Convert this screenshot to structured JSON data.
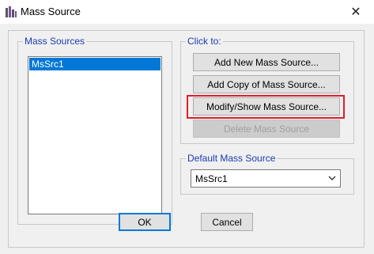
{
  "window": {
    "title": "Mass Source",
    "close_glyph": "✕"
  },
  "mass_sources": {
    "label": "Mass Sources",
    "items": [
      "MsSrc1"
    ]
  },
  "click_to": {
    "label": "Click to:",
    "add_new": "Add New Mass Source...",
    "add_copy": "Add Copy of Mass Source...",
    "modify_show": "Modify/Show Mass Source...",
    "delete": "Delete Mass Source"
  },
  "default_mass_source": {
    "label": "Default Mass Source",
    "selected": "MsSrc1"
  },
  "footer": {
    "ok": "OK",
    "cancel": "Cancel"
  },
  "colors": {
    "group_label": "#1a3cb4",
    "selection": "#0078d7",
    "highlight": "#e11d2c"
  },
  "icons": {
    "app": "app-icon",
    "close": "close-icon",
    "dropdown": "chevron-down-icon"
  }
}
